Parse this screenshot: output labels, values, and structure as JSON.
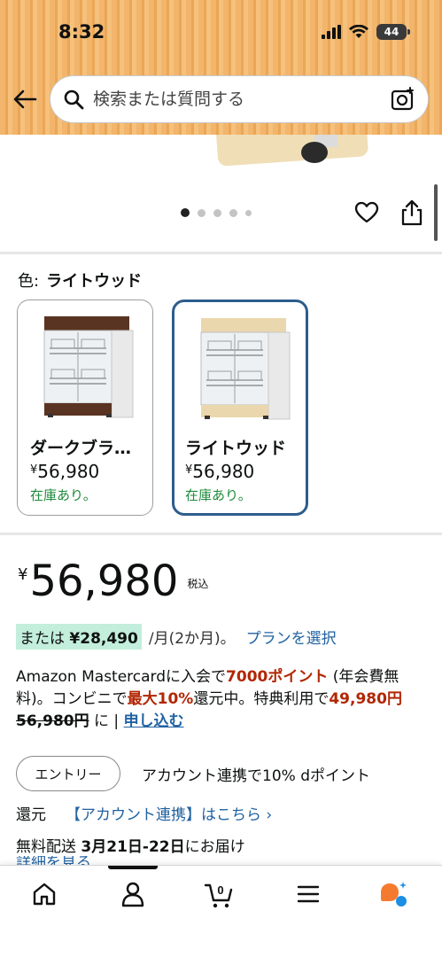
{
  "status_bar": {
    "time": "8:32",
    "battery": "44"
  },
  "search": {
    "placeholder": "検索または質問する"
  },
  "carousel": {
    "dots": 5,
    "active_index": 0
  },
  "color": {
    "label": "色:",
    "selected": "ライトウッド"
  },
  "variants": [
    {
      "name": "ダークブラ…",
      "yen": "¥",
      "price": "56,980",
      "stock": "在庫あり。",
      "selected": false
    },
    {
      "name": "ライトウッド",
      "yen": "¥",
      "price": "56,980",
      "stock": "在庫あり。",
      "selected": true
    }
  ],
  "price": {
    "yen": "¥",
    "amount": "56,980",
    "tax": "税込"
  },
  "installment": {
    "prefix": "または",
    "amount": "¥28,490",
    "per": "/月(2か月)。",
    "plan_link": "プランを選択"
  },
  "mastercard": {
    "t1": "Amazon Mastercardに入会で",
    "points": "7000ポイント",
    "t2": " (年会費無料)。コンビニで",
    "rate": "最大10%",
    "t3": "還元中。特典利用で",
    "discounted": "49,980円",
    "original": "56,980円",
    "t4": " に | ",
    "apply_link": "申し込む"
  },
  "entry": {
    "button": "エントリー",
    "description": "アカウント連携で10% dポイント",
    "kangen": "還元",
    "link": "【アカウント連携】はこちら ›"
  },
  "delivery": {
    "t1": "無料配送 ",
    "dates": "3月21日-22日",
    "t2": "にお届け",
    "more": "詳細を見る"
  },
  "bottom_nav": {
    "items": [
      "home",
      "account",
      "cart",
      "menu",
      "rufus"
    ],
    "cart_count": "0"
  },
  "colors": {
    "accent_blue": "#2162a1",
    "price_red": "#b12704",
    "stock_green": "#1d8a3a",
    "selected_border": "#2d5d8c",
    "highlight": "#c2eedb"
  }
}
